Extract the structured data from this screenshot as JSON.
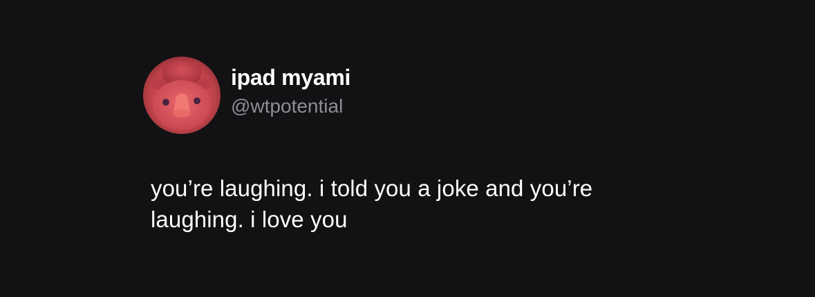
{
  "tweet": {
    "author": {
      "display_name": "ipad myami",
      "handle": "@wtpotential",
      "avatar_icon": "duck-with-hat-avatar-icon"
    },
    "text_lines": [
      "you’re laughing. i told you a joke and you’re",
      "laughing. i love you"
    ]
  },
  "colors": {
    "background": "#121113",
    "display_name": "#ffffff",
    "handle": "#8e8e93",
    "body_text": "#ffffff",
    "avatar_base": "#c9474e"
  }
}
